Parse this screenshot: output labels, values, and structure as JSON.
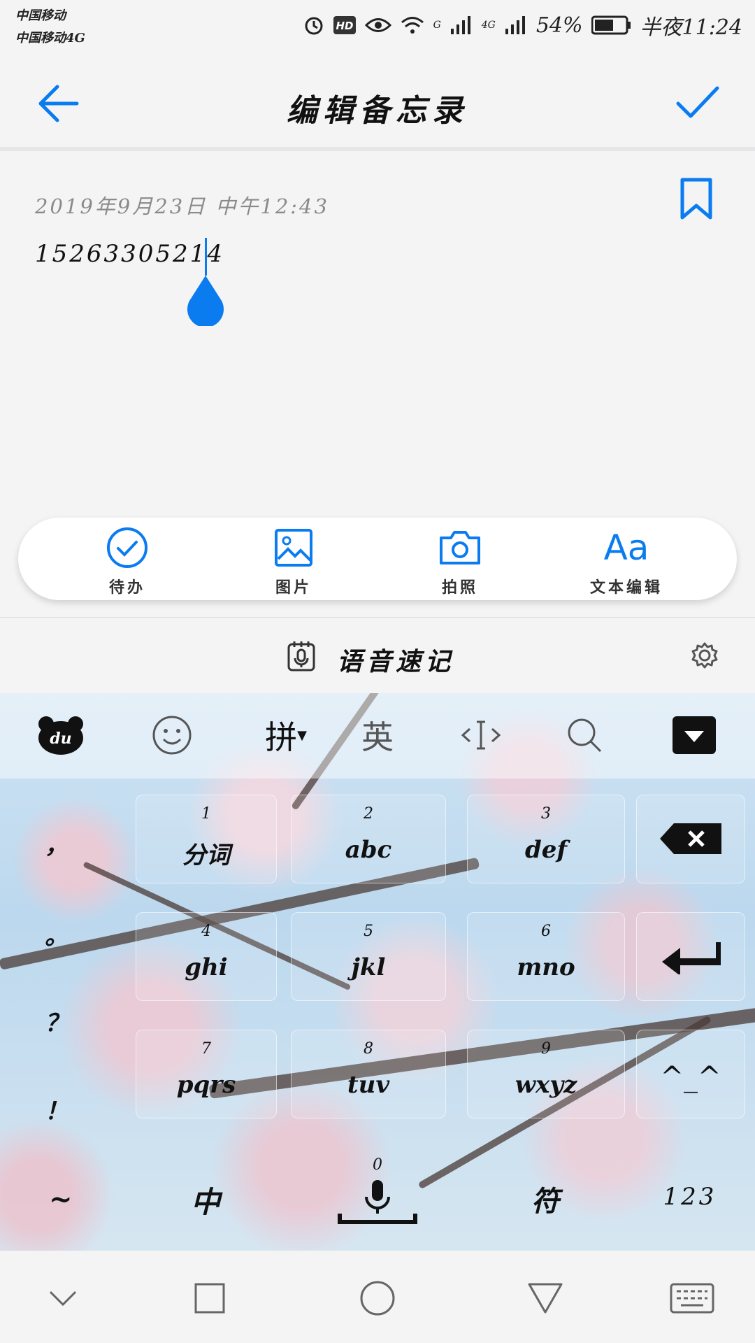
{
  "status_bar": {
    "carrier1": "中国移动",
    "carrier2": "中国移动4G",
    "net1": "G",
    "net2": "4G",
    "battery": "54%",
    "time": "半夜11:24"
  },
  "header": {
    "title": "编辑备忘录"
  },
  "note": {
    "date": "2019年9月23日  中午12:43",
    "text": "15263305214"
  },
  "toolbar": {
    "todo": "待办",
    "picture": "图片",
    "camera": "拍照",
    "text_edit_icon": "Aa",
    "text_edit": "文本编辑"
  },
  "voice": {
    "label": "语音速记"
  },
  "keyboard": {
    "mode_pinyin": "拼",
    "mode_english": "英",
    "side_keys": [
      "，",
      "。",
      "？",
      "！"
    ],
    "keys": [
      {
        "num": "1",
        "label": "分词"
      },
      {
        "num": "2",
        "label": "abc"
      },
      {
        "num": "3",
        "label": "def"
      },
      {
        "num": "4",
        "label": "ghi"
      },
      {
        "num": "5",
        "label": "jkl"
      },
      {
        "num": "6",
        "label": "mno"
      },
      {
        "num": "7",
        "label": "pqrs"
      },
      {
        "num": "8",
        "label": "tuv"
      },
      {
        "num": "9",
        "label": "wxyz"
      }
    ],
    "tilde": "~",
    "zh": "中",
    "zero": "0",
    "symbol": "符",
    "numbers": "123",
    "emoticon": "^_^"
  },
  "colors": {
    "accent": "#0a7cf0"
  }
}
